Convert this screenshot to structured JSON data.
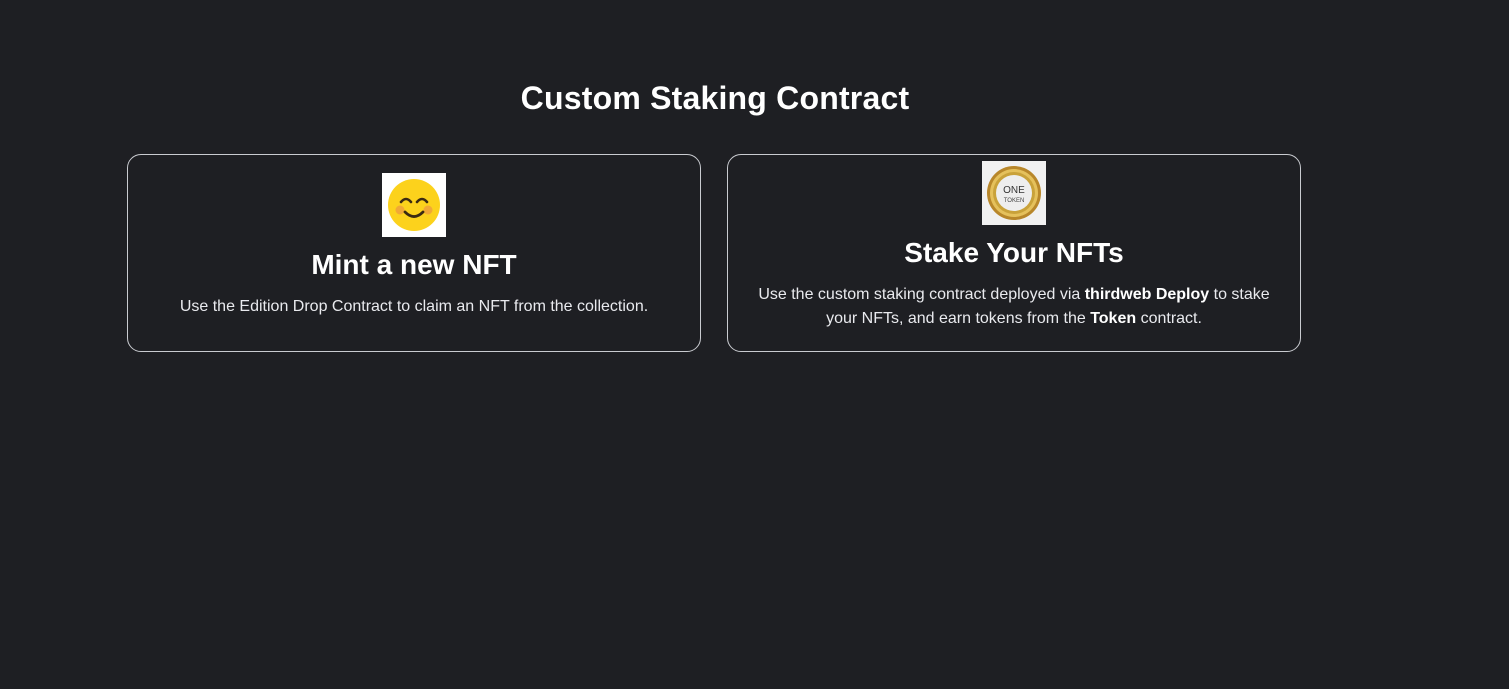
{
  "page": {
    "title": "Custom Staking Contract"
  },
  "cards": [
    {
      "icon": "smiling-face-emoji-icon",
      "title": "Mint a new NFT",
      "description": "Use the Edition Drop Contract to claim an NFT from the collection."
    },
    {
      "icon": "one-token-coin-icon",
      "icon_text_top": "ONE",
      "icon_text_bottom": "TOKEN",
      "title": "Stake Your NFTs",
      "description_parts": [
        "Use the custom staking contract deployed via ",
        "thirdweb Deploy",
        " to stake your NFTs, and earn tokens from the ",
        "Token",
        " contract."
      ]
    }
  ],
  "colors": {
    "background": "#1e1f23",
    "card_border": "#c9cbd0",
    "text": "#ffffff",
    "emoji_face": "#fcd21c",
    "coin_gold": "#c9a23a"
  }
}
